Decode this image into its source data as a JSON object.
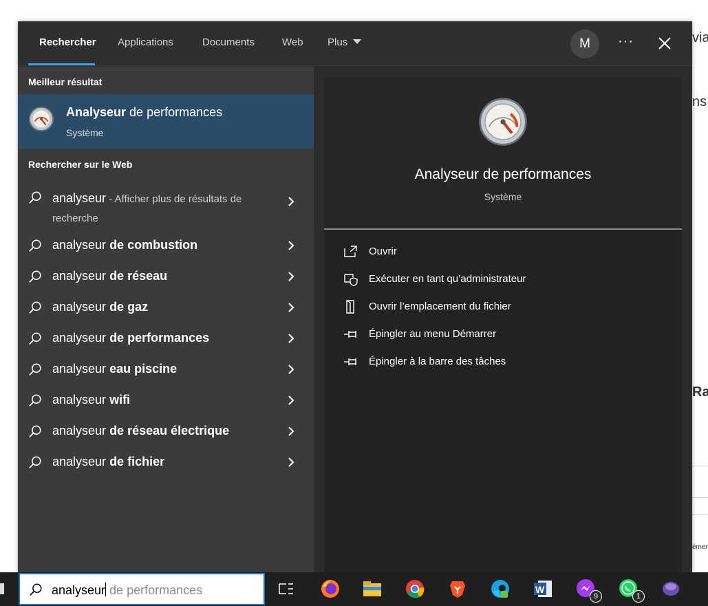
{
  "background": {
    "fragments": [
      "via",
      "ns",
      "Rap",
      "émen"
    ]
  },
  "search_panel": {
    "tabs": [
      {
        "label": "Rechercher",
        "active": true
      },
      {
        "label": "Applications",
        "active": false
      },
      {
        "label": "Documents",
        "active": false
      },
      {
        "label": "Web",
        "active": false
      },
      {
        "label": "Plus",
        "active": false
      }
    ],
    "avatar_initial": "M",
    "more_label": "···",
    "best_match": {
      "section_title": "Meilleur résultat",
      "title_bold": "Analyseur",
      "title_rest": " de performances",
      "subtitle": "Système",
      "icon": "gauge-icon"
    },
    "web": {
      "section_title": "Rechercher sur le Web",
      "first": {
        "query": "analyseur",
        "suffix": " - Afficher plus de résultats de recherche"
      },
      "items": [
        {
          "prefix": "analyseur ",
          "bold": "de combustion"
        },
        {
          "prefix": "analyseur ",
          "bold": "de réseau"
        },
        {
          "prefix": "analyseur ",
          "bold": "de gaz"
        },
        {
          "prefix": "analyseur ",
          "bold": "de performances"
        },
        {
          "prefix": "analyseur ",
          "bold": "eau piscine"
        },
        {
          "prefix": "analyseur ",
          "bold": "wifi"
        },
        {
          "prefix": "analyseur ",
          "bold": "de réseau électrique"
        },
        {
          "prefix": "analyseur ",
          "bold": "de fichier"
        }
      ]
    },
    "preview": {
      "title": "Analyseur de performances",
      "subtitle": "Système",
      "actions": [
        {
          "label": "Ouvrir",
          "icon": "open-icon"
        },
        {
          "label": "Exécuter en tant qu’administrateur",
          "icon": "admin-shield-icon"
        },
        {
          "label": "Ouvrir l’emplacement du fichier",
          "icon": "file-location-icon"
        },
        {
          "label": "Épingler au menu Démarrer",
          "icon": "pin-icon"
        },
        {
          "label": "Épingler à la barre des tâches",
          "icon": "pin-icon"
        }
      ]
    }
  },
  "taskbar": {
    "search_typed": "analyseur",
    "search_hint": " de performances",
    "apps": [
      {
        "name": "task-view-icon"
      },
      {
        "name": "firefox-icon"
      },
      {
        "name": "file-explorer-icon"
      },
      {
        "name": "chrome-icon"
      },
      {
        "name": "brave-icon"
      },
      {
        "name": "edge-icon"
      },
      {
        "name": "word-icon"
      },
      {
        "name": "messenger-icon",
        "badge": "9"
      },
      {
        "name": "whatsapp-icon",
        "badge": "1"
      },
      {
        "name": "app-icon"
      }
    ],
    "accent": "#1a73c9"
  }
}
